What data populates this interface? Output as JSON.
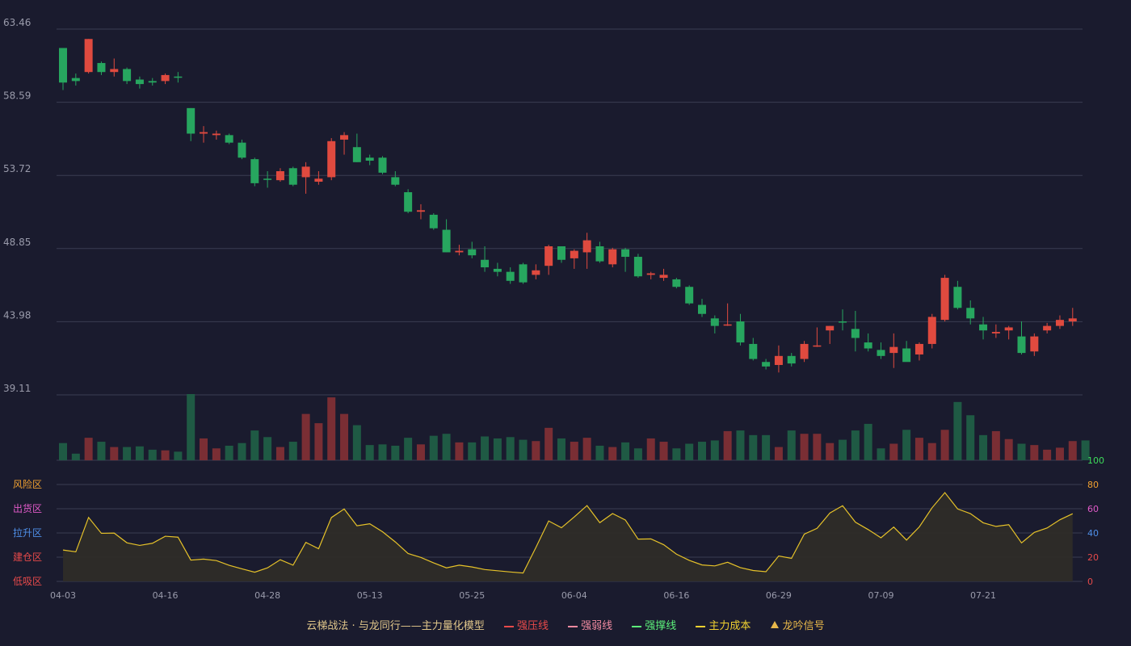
{
  "colors": {
    "up": "#e04a3f",
    "down": "#27a65f",
    "vol_up": "#7a2e34",
    "vol_down": "#1f5a44",
    "grid": "#3a3c52",
    "axis_text": "#9a9bab",
    "osc_line": "#e6c229",
    "osc_fill": "#2e2c28",
    "risk": "#f0a030",
    "sell": "#e05ac8",
    "rise": "#4f8fe8",
    "build": "#e84a4a",
    "low": "#e84a4a",
    "r100": "#3ddc5a",
    "r80": "#f0a030",
    "r60": "#e05ac8",
    "r40": "#4f8fe8",
    "r20": "#e84a4a",
    "r0": "#e84a4a"
  },
  "chart_data": {
    "type": "candlestick",
    "price_axis": {
      "ticks": [
        "63.46",
        "58.59",
        "53.72",
        "48.85",
        "43.98",
        "39.11"
      ],
      "ylim": [
        39.11,
        63.46
      ]
    },
    "x_labels": [
      "04-03",
      "04-16",
      "04-28",
      "05-13",
      "05-25",
      "06-04",
      "06-16",
      "06-29",
      "07-09",
      "07-21"
    ],
    "candles": [
      {
        "o": 59.9,
        "h": 61.7,
        "l": 59.4,
        "c": 62.2,
        "d": "down"
      },
      {
        "o": 60.2,
        "h": 60.5,
        "l": 59.7,
        "c": 60.0,
        "d": "down"
      },
      {
        "o": 60.6,
        "h": 62.8,
        "l": 60.5,
        "c": 62.8,
        "d": "up"
      },
      {
        "o": 61.2,
        "h": 61.3,
        "l": 60.4,
        "c": 60.6,
        "d": "down"
      },
      {
        "o": 60.6,
        "h": 61.5,
        "l": 60.3,
        "c": 60.8,
        "d": "up"
      },
      {
        "o": 60.8,
        "h": 60.9,
        "l": 59.8,
        "c": 60.0,
        "d": "down"
      },
      {
        "o": 60.1,
        "h": 60.3,
        "l": 59.5,
        "c": 59.8,
        "d": "down"
      },
      {
        "o": 60.0,
        "h": 60.2,
        "l": 59.7,
        "c": 59.9,
        "d": "down"
      },
      {
        "o": 60.0,
        "h": 60.5,
        "l": 59.8,
        "c": 60.4,
        "d": "up"
      },
      {
        "o": 60.3,
        "h": 60.6,
        "l": 59.9,
        "c": 60.3,
        "d": "down"
      },
      {
        "o": 58.2,
        "h": 58.2,
        "l": 56.0,
        "c": 56.5,
        "d": "down"
      },
      {
        "o": 56.5,
        "h": 57.0,
        "l": 55.9,
        "c": 56.6,
        "d": "up"
      },
      {
        "o": 56.5,
        "h": 56.7,
        "l": 56.1,
        "c": 56.4,
        "d": "up"
      },
      {
        "o": 56.4,
        "h": 56.5,
        "l": 55.8,
        "c": 55.9,
        "d": "down"
      },
      {
        "o": 55.9,
        "h": 56.1,
        "l": 54.8,
        "c": 54.9,
        "d": "down"
      },
      {
        "o": 54.8,
        "h": 54.9,
        "l": 53.0,
        "c": 53.2,
        "d": "down"
      },
      {
        "o": 53.5,
        "h": 54.0,
        "l": 52.9,
        "c": 53.5,
        "d": "down"
      },
      {
        "o": 53.4,
        "h": 54.2,
        "l": 53.3,
        "c": 54.0,
        "d": "up"
      },
      {
        "o": 54.2,
        "h": 54.3,
        "l": 53.0,
        "c": 53.1,
        "d": "down"
      },
      {
        "o": 53.6,
        "h": 54.6,
        "l": 52.5,
        "c": 54.3,
        "d": "up"
      },
      {
        "o": 53.3,
        "h": 54.0,
        "l": 53.1,
        "c": 53.5,
        "d": "up"
      },
      {
        "o": 53.6,
        "h": 56.2,
        "l": 53.4,
        "c": 56.0,
        "d": "up"
      },
      {
        "o": 56.1,
        "h": 56.6,
        "l": 55.1,
        "c": 56.4,
        "d": "up"
      },
      {
        "o": 55.6,
        "h": 56.5,
        "l": 54.6,
        "c": 54.6,
        "d": "down"
      },
      {
        "o": 54.9,
        "h": 55.1,
        "l": 54.4,
        "c": 54.7,
        "d": "down"
      },
      {
        "o": 54.9,
        "h": 55.0,
        "l": 53.8,
        "c": 53.9,
        "d": "down"
      },
      {
        "o": 53.6,
        "h": 54.0,
        "l": 53.0,
        "c": 53.1,
        "d": "down"
      },
      {
        "o": 52.6,
        "h": 52.8,
        "l": 51.2,
        "c": 51.3,
        "d": "down"
      },
      {
        "o": 51.3,
        "h": 51.8,
        "l": 50.8,
        "c": 51.4,
        "d": "up"
      },
      {
        "o": 51.1,
        "h": 51.2,
        "l": 50.1,
        "c": 50.2,
        "d": "down"
      },
      {
        "o": 50.1,
        "h": 50.8,
        "l": 48.6,
        "c": 48.6,
        "d": "down"
      },
      {
        "o": 48.6,
        "h": 49.1,
        "l": 48.4,
        "c": 48.7,
        "d": "up"
      },
      {
        "o": 48.8,
        "h": 49.3,
        "l": 48.2,
        "c": 48.4,
        "d": "down"
      },
      {
        "o": 48.1,
        "h": 49.0,
        "l": 47.3,
        "c": 47.6,
        "d": "down"
      },
      {
        "o": 47.5,
        "h": 47.9,
        "l": 47.0,
        "c": 47.3,
        "d": "down"
      },
      {
        "o": 47.3,
        "h": 47.6,
        "l": 46.5,
        "c": 46.7,
        "d": "down"
      },
      {
        "o": 47.8,
        "h": 47.9,
        "l": 46.5,
        "c": 46.6,
        "d": "down"
      },
      {
        "o": 47.1,
        "h": 47.8,
        "l": 46.8,
        "c": 47.4,
        "d": "up"
      },
      {
        "o": 47.7,
        "h": 49.1,
        "l": 47.1,
        "c": 49.0,
        "d": "up"
      },
      {
        "o": 49.0,
        "h": 49.0,
        "l": 47.9,
        "c": 48.1,
        "d": "down"
      },
      {
        "o": 48.2,
        "h": 48.8,
        "l": 47.5,
        "c": 48.7,
        "d": "up"
      },
      {
        "o": 48.6,
        "h": 49.9,
        "l": 47.5,
        "c": 49.4,
        "d": "up"
      },
      {
        "o": 49.0,
        "h": 49.3,
        "l": 47.9,
        "c": 48.0,
        "d": "down"
      },
      {
        "o": 47.8,
        "h": 48.9,
        "l": 47.6,
        "c": 48.8,
        "d": "up"
      },
      {
        "o": 48.8,
        "h": 48.9,
        "l": 47.3,
        "c": 48.3,
        "d": "down"
      },
      {
        "o": 48.3,
        "h": 48.5,
        "l": 46.9,
        "c": 47.0,
        "d": "down"
      },
      {
        "o": 47.1,
        "h": 47.3,
        "l": 46.8,
        "c": 47.2,
        "d": "up"
      },
      {
        "o": 47.1,
        "h": 47.5,
        "l": 46.7,
        "c": 46.9,
        "d": "up"
      },
      {
        "o": 46.8,
        "h": 46.9,
        "l": 46.2,
        "c": 46.3,
        "d": "down"
      },
      {
        "o": 46.3,
        "h": 46.4,
        "l": 45.1,
        "c": 45.2,
        "d": "down"
      },
      {
        "o": 45.1,
        "h": 45.5,
        "l": 44.3,
        "c": 44.5,
        "d": "down"
      },
      {
        "o": 44.2,
        "h": 44.4,
        "l": 43.2,
        "c": 43.7,
        "d": "down"
      },
      {
        "o": 43.8,
        "h": 45.2,
        "l": 43.7,
        "c": 43.8,
        "d": "up"
      },
      {
        "o": 44.0,
        "h": 44.5,
        "l": 42.4,
        "c": 42.6,
        "d": "down"
      },
      {
        "o": 42.5,
        "h": 42.9,
        "l": 41.4,
        "c": 41.5,
        "d": "down"
      },
      {
        "o": 41.3,
        "h": 41.5,
        "l": 40.8,
        "c": 41.0,
        "d": "down"
      },
      {
        "o": 41.1,
        "h": 42.4,
        "l": 40.6,
        "c": 41.7,
        "d": "up"
      },
      {
        "o": 41.7,
        "h": 41.9,
        "l": 41.0,
        "c": 41.2,
        "d": "down"
      },
      {
        "o": 41.5,
        "h": 42.7,
        "l": 41.3,
        "c": 42.5,
        "d": "up"
      },
      {
        "o": 42.4,
        "h": 43.6,
        "l": 42.3,
        "c": 42.4,
        "d": "up"
      },
      {
        "o": 43.4,
        "h": 43.7,
        "l": 42.5,
        "c": 43.7,
        "d": "up"
      },
      {
        "o": 44.0,
        "h": 44.8,
        "l": 43.4,
        "c": 44.0,
        "d": "down"
      },
      {
        "o": 43.5,
        "h": 44.7,
        "l": 42.0,
        "c": 42.9,
        "d": "down"
      },
      {
        "o": 42.6,
        "h": 43.2,
        "l": 42.0,
        "c": 42.2,
        "d": "down"
      },
      {
        "o": 42.1,
        "h": 42.6,
        "l": 41.5,
        "c": 41.7,
        "d": "down"
      },
      {
        "o": 41.9,
        "h": 43.2,
        "l": 40.9,
        "c": 42.3,
        "d": "up"
      },
      {
        "o": 42.2,
        "h": 42.7,
        "l": 41.6,
        "c": 41.3,
        "d": "down"
      },
      {
        "o": 41.8,
        "h": 42.6,
        "l": 41.4,
        "c": 42.5,
        "d": "up"
      },
      {
        "o": 42.5,
        "h": 44.5,
        "l": 42.2,
        "c": 44.3,
        "d": "up"
      },
      {
        "o": 44.1,
        "h": 47.1,
        "l": 44.0,
        "c": 46.9,
        "d": "up"
      },
      {
        "o": 46.3,
        "h": 46.7,
        "l": 44.8,
        "c": 44.9,
        "d": "down"
      },
      {
        "o": 44.9,
        "h": 45.4,
        "l": 43.8,
        "c": 44.2,
        "d": "down"
      },
      {
        "o": 43.8,
        "h": 44.3,
        "l": 42.8,
        "c": 43.4,
        "d": "down"
      },
      {
        "o": 43.2,
        "h": 43.8,
        "l": 42.9,
        "c": 43.3,
        "d": "up"
      },
      {
        "o": 43.4,
        "h": 43.7,
        "l": 42.8,
        "c": 43.6,
        "d": "up"
      },
      {
        "o": 43.0,
        "h": 44.0,
        "l": 41.8,
        "c": 41.9,
        "d": "down"
      },
      {
        "o": 42.0,
        "h": 43.2,
        "l": 41.7,
        "c": 43.0,
        "d": "up"
      },
      {
        "o": 43.4,
        "h": 43.9,
        "l": 43.2,
        "c": 43.7,
        "d": "up"
      },
      {
        "o": 43.7,
        "h": 44.4,
        "l": 43.5,
        "c": 44.1,
        "d": "up"
      },
      {
        "o": 44.0,
        "h": 44.9,
        "l": 43.7,
        "c": 44.2,
        "d": "up"
      }
    ],
    "volume": [
      26,
      10,
      34,
      28,
      20,
      20,
      21,
      16,
      15,
      13,
      100,
      33,
      18,
      22,
      26,
      45,
      35,
      20,
      28,
      70,
      56,
      95,
      70,
      53,
      23,
      24,
      22,
      34,
      24,
      37,
      40,
      27,
      27,
      36,
      33,
      35,
      31,
      29,
      49,
      33,
      28,
      34,
      22,
      20,
      27,
      18,
      33,
      28,
      18,
      25,
      28,
      30,
      44,
      45,
      38,
      38,
      20,
      45,
      40,
      40,
      26,
      31,
      45,
      55,
      18,
      25,
      46,
      34,
      26,
      46,
      88,
      68,
      38,
      44,
      32,
      25,
      23,
      16,
      19,
      29,
      30
    ],
    "oscillator": {
      "zones": [
        "风险区",
        "出货区",
        "拉升区",
        "建仓区",
        "低吸区"
      ],
      "right_ticks": [
        "100",
        "80",
        "60",
        "40",
        "20",
        "0"
      ],
      "ylim": [
        0,
        100
      ],
      "values": [
        25.9,
        24.4,
        52.8,
        39.7,
        39.9,
        31.9,
        29.7,
        31.5,
        37.3,
        36.5,
        17.6,
        18.4,
        17.2,
        13.3,
        10.4,
        7.6,
        11.2,
        17.9,
        13.4,
        32.2,
        27.0,
        52.7,
        59.8,
        45.9,
        47.6,
        41.0,
        32.6,
        23.0,
        19.8,
        15.3,
        11.2,
        13.4,
        11.9,
        9.8,
        8.8,
        7.8,
        6.9,
        28.0,
        49.9,
        44.3,
        53.2,
        62.6,
        48.5,
        56.0,
        50.7,
        34.9,
        35.1,
        30.3,
        22.5,
        17.4,
        13.6,
        12.8,
        15.8,
        11.4,
        9.0,
        8.0,
        21.0,
        19.0,
        39.0,
        43.8,
        56.4,
        62.5,
        48.9,
        42.8,
        36.0,
        44.9,
        34.1,
        45.0,
        60.8,
        73.3,
        59.8,
        56.0,
        48.4,
        45.4,
        46.8,
        31.8,
        40.5,
        44.1,
        50.9,
        55.9
      ]
    }
  },
  "legend": {
    "title": "云梯战法 · 与龙同行——主力量化模型",
    "strong_pressure": "强压线",
    "weak_pressure": "强弱线",
    "strong_support": "强撑线",
    "main_cost": "主力成本",
    "signal": "龙吟信号"
  }
}
